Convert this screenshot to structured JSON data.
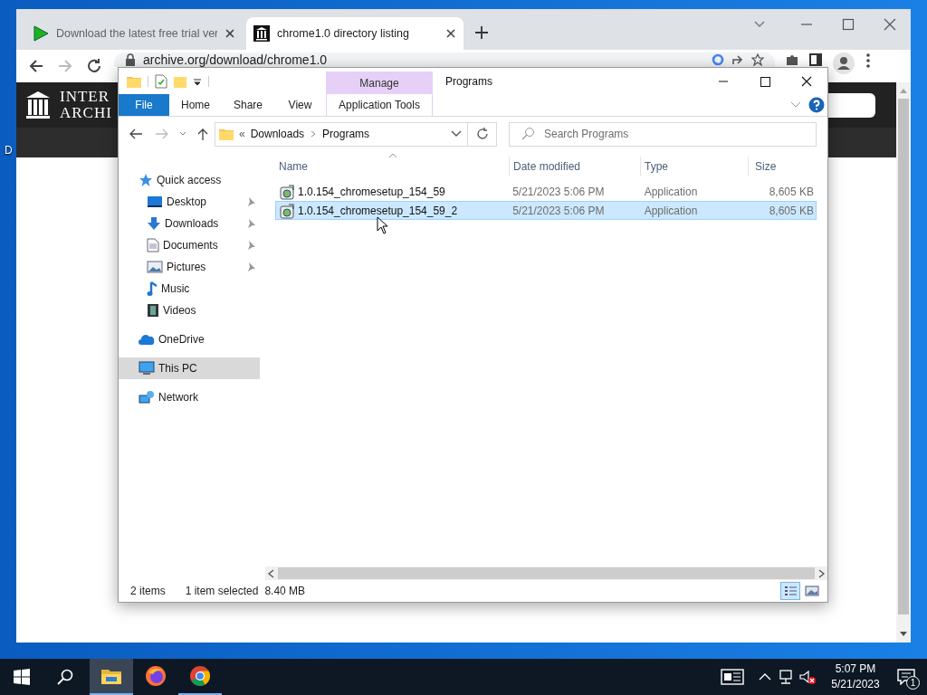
{
  "desktop": {
    "icon_labels": [
      "D"
    ]
  },
  "browser": {
    "tabs": [
      {
        "title": "Download the latest free trial ver",
        "selected": false
      },
      {
        "title": "chrome1.0 directory listing",
        "selected": true
      }
    ],
    "address": "archive.org/download/chrome1.0",
    "page": {
      "logo_lines": [
        "INTER",
        "ARCHI"
      ]
    }
  },
  "explorer": {
    "title": "Programs",
    "contextual_group": "Manage",
    "ribbon_tabs": [
      {
        "label": "File",
        "kind": "file"
      },
      {
        "label": "Home",
        "kind": "tab"
      },
      {
        "label": "Share",
        "kind": "tab"
      },
      {
        "label": "View",
        "kind": "tab"
      },
      {
        "label": "Application Tools",
        "kind": "contextual"
      }
    ],
    "breadcrumb": {
      "overflow": "«",
      "segments": [
        "Downloads",
        "Programs"
      ]
    },
    "search": {
      "placeholder": "Search Programs"
    },
    "sidebar": {
      "items": [
        {
          "label": "Quick access",
          "selected": false,
          "children": [
            {
              "label": "Desktop",
              "pinned": true,
              "selected": false
            },
            {
              "label": "Downloads",
              "pinned": true,
              "selected": false
            },
            {
              "label": "Documents",
              "pinned": true,
              "selected": false
            },
            {
              "label": "Pictures",
              "pinned": true,
              "selected": false
            },
            {
              "label": "Music",
              "pinned": false,
              "selected": false
            },
            {
              "label": "Videos",
              "pinned": false,
              "selected": false
            }
          ]
        },
        {
          "label": "OneDrive",
          "selected": false
        },
        {
          "label": "This PC",
          "selected": true
        },
        {
          "label": "Network",
          "selected": false
        }
      ]
    },
    "columns": [
      "Name",
      "Date modified",
      "Type",
      "Size"
    ],
    "files": [
      {
        "name": "1.0.154_chromesetup_154_59",
        "date_modified": "5/21/2023 5:06 PM",
        "type": "Application",
        "size": "8,605 KB",
        "selected": false
      },
      {
        "name": "1.0.154_chromesetup_154_59_2",
        "date_modified": "5/21/2023 5:06 PM",
        "type": "Application",
        "size": "8,605 KB",
        "selected": true
      }
    ],
    "status_bar": {
      "item_count": "2 items",
      "selection": "1 item selected",
      "selection_size": "8.40 MB"
    },
    "view_buttons": [
      {
        "kind": "details",
        "selected": true
      },
      {
        "kind": "large_icons",
        "selected": false
      }
    ]
  },
  "taskbar": {
    "apps": [
      {
        "kind": "explorer",
        "running": true,
        "active": true
      },
      {
        "kind": "firefox",
        "running": false,
        "active": false
      },
      {
        "kind": "chrome",
        "running": true,
        "active": false
      }
    ],
    "clock": {
      "time": "5:07 PM",
      "date": "5/21/2023"
    },
    "notification_count": "1"
  }
}
